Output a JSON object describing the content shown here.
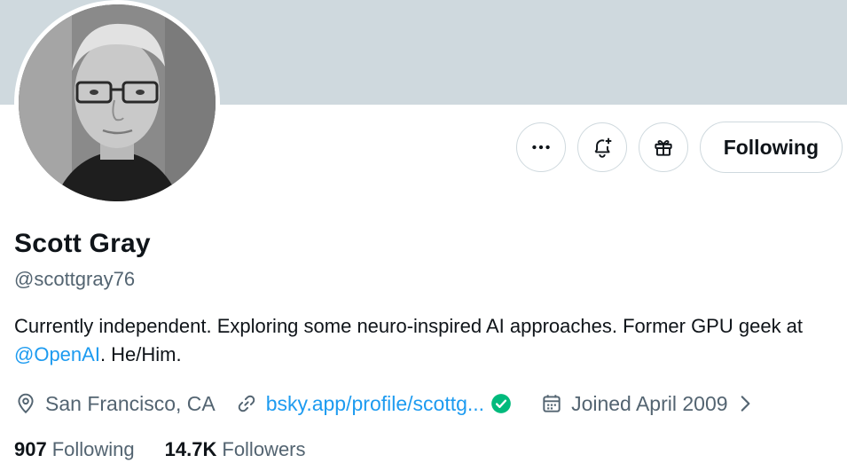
{
  "profile": {
    "name": "Scott Gray",
    "handle": "@scottgray76",
    "bio_part1": "Currently independent.  Exploring some neuro-inspired AI approaches.  Former GPU geek at ",
    "bio_mention": "@OpenAI",
    "bio_part2": ".  He/Him.",
    "location": "San Francisco, CA",
    "website": "bsky.app/profile/scottg...",
    "joined": "Joined April 2009"
  },
  "actions": {
    "more_icon": "more-horizontal-icon",
    "notify_icon": "bell-plus-icon",
    "gift_icon": "gift-icon",
    "follow_label": "Following"
  },
  "stats": {
    "following_count": "907",
    "following_label": "Following",
    "followers_count": "14.7K",
    "followers_label": "Followers"
  },
  "colors": {
    "banner": "#cfd9de",
    "link": "#1d9bf0",
    "verified": "#00ba7c",
    "secondary_text": "#536471"
  }
}
